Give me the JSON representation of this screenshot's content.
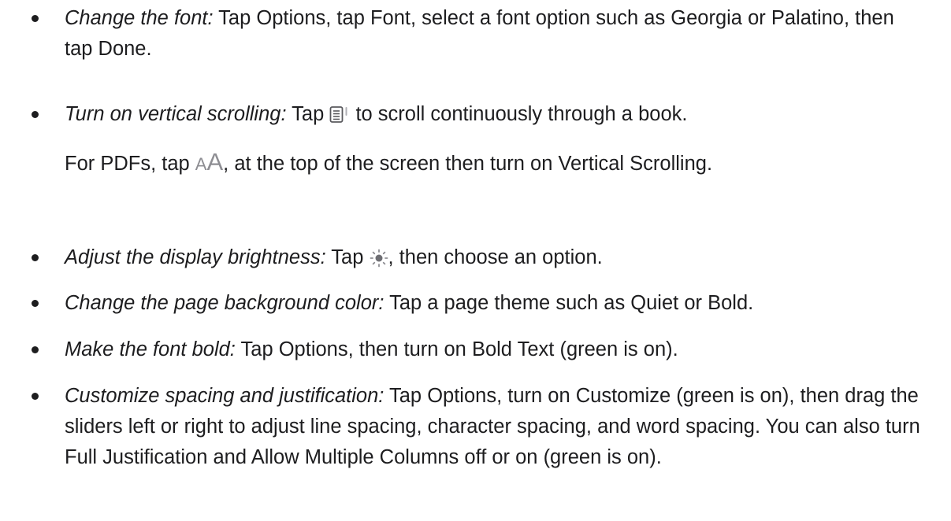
{
  "items": [
    {
      "lead": "Change the font:",
      "body": " Tap Options, tap Font, select a font option such as Georgia or Palatino, then tap Done."
    },
    {
      "lead": "Turn on vertical scrolling:",
      "body_before": " Tap ",
      "icon": "vertical-scroll-icon",
      "body_after": " to scroll continuously through a book.",
      "sub_before": "For PDFs, tap ",
      "sub_icon": "text-size-icon",
      "sub_icon_small": "A",
      "sub_icon_big": "A",
      "sub_after": ", at the top of the screen then turn on Vertical Scrolling."
    },
    {
      "lead": "Adjust the display brightness:",
      "body_before": " Tap ",
      "icon": "brightness-icon",
      "body_after": ", then choose an option."
    },
    {
      "lead": "Change the page background color:",
      "body": " Tap a page theme such as Quiet or Bold."
    },
    {
      "lead": "Make the font bold:",
      "body": " Tap Options, then turn on Bold Text (green is on)."
    },
    {
      "lead": "Customize spacing and justification:",
      "body": " Tap Options, turn on Customize (green is on), then drag the sliders left or right to adjust line spacing, character spacing, and word spacing. You can also turn Full Justification and Allow Multiple Columns off or on (green is on)."
    }
  ]
}
